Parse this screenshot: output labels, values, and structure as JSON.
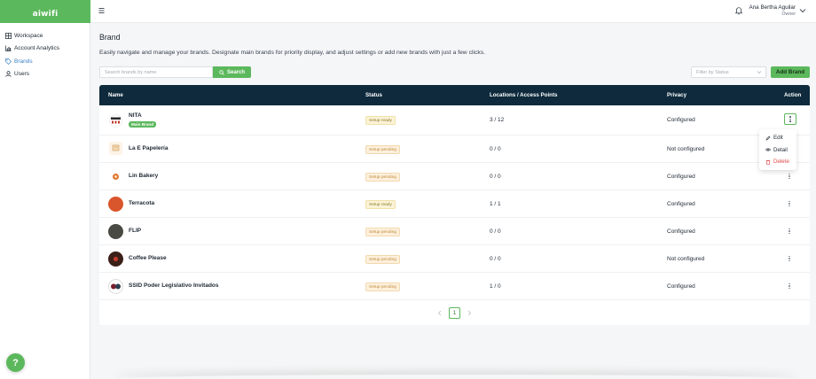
{
  "app": {
    "logo_text": "aiwifi"
  },
  "sidebar": {
    "items": [
      {
        "label": "Workspace",
        "icon": "grid-icon",
        "active": false
      },
      {
        "label": "Account Analytics",
        "icon": "chart-icon",
        "active": false
      },
      {
        "label": "Brands",
        "icon": "tag-icon",
        "active": true
      },
      {
        "label": "Users",
        "icon": "user-icon",
        "active": false
      }
    ]
  },
  "header": {
    "user_name": "Ana Bertha Aguilar",
    "user_role": "Owner"
  },
  "page": {
    "title": "Brand",
    "description": "Easily navigate and manage your brands. Designate main brands for priority display, and adjust settings or add new brands with just a few clicks."
  },
  "toolbar": {
    "search_placeholder": "Search brands by name",
    "search_label": "Search",
    "filter_placeholder": "Filter by Status",
    "add_label": "Add Brand"
  },
  "table": {
    "columns": [
      "Name",
      "Status",
      "Locations / Access Points",
      "Privacy",
      "Action"
    ],
    "rows": [
      {
        "name": "NITA",
        "badge": "Main Brand",
        "status": "Setup ready",
        "locations": "3 / 12",
        "privacy": "Configured"
      },
      {
        "name": "La E Papelería",
        "status": "Setup pending",
        "locations": "0 / 0",
        "privacy": "Not configured"
      },
      {
        "name": "Lin Bakery",
        "status": "Setup pending",
        "locations": "0 / 0",
        "privacy": "Configured"
      },
      {
        "name": "Terracota",
        "status": "Setup ready",
        "locations": "1 / 1",
        "privacy": "Configured"
      },
      {
        "name": "FLIP",
        "status": "Setup pending",
        "locations": "0 / 0",
        "privacy": "Configured"
      },
      {
        "name": "Coffee Please",
        "status": "Setup pending",
        "locations": "0 / 0",
        "privacy": "Not configured"
      },
      {
        "name": "SSID Poder Legislativo Invitados",
        "status": "Setup pending",
        "locations": "1 / 0",
        "privacy": "Configured"
      }
    ]
  },
  "pagination": {
    "current_page": "1"
  },
  "action_menu": {
    "edit": "Edit",
    "detail": "Detail",
    "delete": "Delete"
  },
  "help": {
    "label": "?"
  },
  "colors": {
    "brand_green": "#5cb85c",
    "table_header": "#0e2a3c",
    "danger": "#e04848",
    "active_nav": "#3b82c4"
  }
}
